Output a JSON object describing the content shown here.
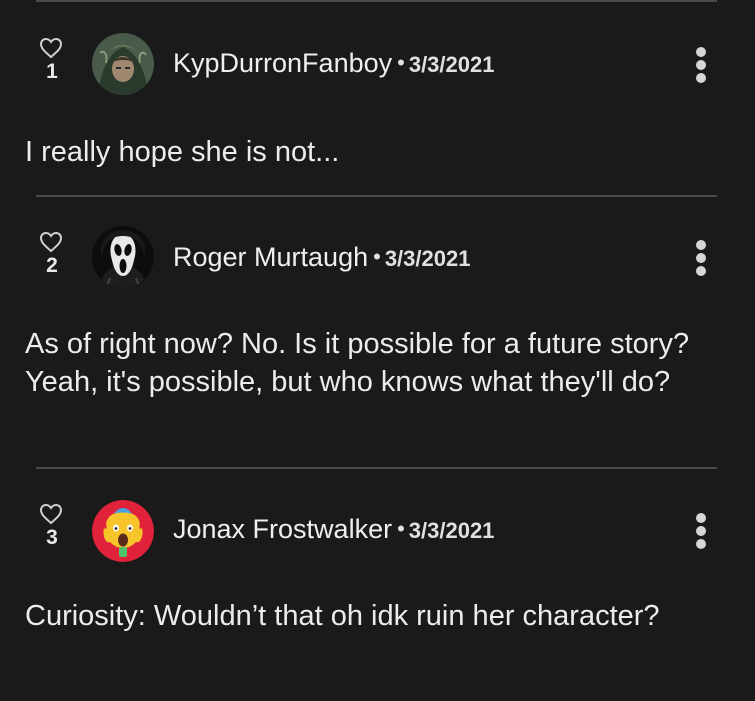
{
  "comments": [
    {
      "likes": "1",
      "author": "KypDurronFanboy",
      "separator": "•",
      "date": "3/3/2021",
      "text": "I really hope she is not...",
      "avatar_icon": "hooded-figure-avatar"
    },
    {
      "likes": "2",
      "author": "Roger Murtaugh",
      "separator": "•",
      "date": "3/3/2021",
      "text": "As of right now? No. Is it possible for a future story? Yeah, it's possible, but who knows what they'll do?",
      "avatar_icon": "ghostface-mask-avatar"
    },
    {
      "likes": "3",
      "author": "Jonax Frostwalker",
      "separator": "•",
      "date": "3/3/2021",
      "text": "Curiosity: Wouldn’t that oh idk ruin her character?",
      "avatar_icon": "screaming-emoji-avatar"
    }
  ],
  "icons": {
    "like": "heart-outline-icon",
    "more": "vertical-ellipsis-icon"
  },
  "colors": {
    "background": "#1a1a1a",
    "divider": "#4a4a4a",
    "text": "#ececec",
    "avatar3_bg": "#e0233a"
  }
}
